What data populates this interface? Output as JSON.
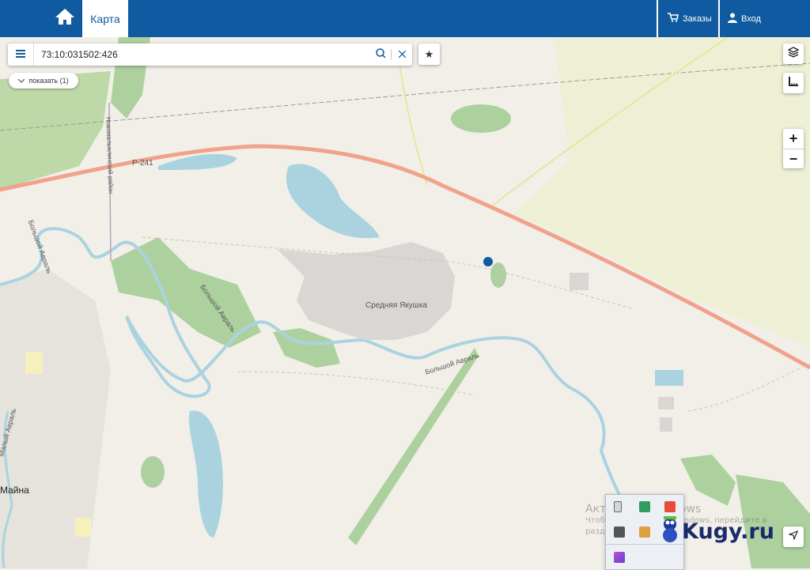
{
  "header": {
    "home_icon": "home-icon",
    "tab_map": "Карта",
    "orders": "Заказы",
    "login": "Вход"
  },
  "search": {
    "value": "73:10:031502:426",
    "search_icon": "search-icon",
    "clear_icon": "close-icon"
  },
  "favorite_icon": "star-icon",
  "results_toggle": "показать (1)",
  "controls": {
    "layers_icon": "layers-icon",
    "ruler_icon": "measure-icon",
    "zoom_in": "+",
    "zoom_out": "−",
    "locate_icon": "locate-icon"
  },
  "map": {
    "labels": {
      "road": "Р-241",
      "settlement": "Средняя Якушка",
      "river_1": "Большой Авраль",
      "river_2": "Большой Авраль",
      "river_3": "Большой Авраль",
      "river_left": "Малый Авраль",
      "district_line": "Новомалыклинский район",
      "town": "Майна"
    },
    "colors": {
      "background": "#f2efe9",
      "forest": "#add19e",
      "field": "#eef0d5",
      "water": "#aad3df",
      "road": "#f0a28a",
      "built": "#d9d7d4",
      "marker": "#0f5aa0"
    }
  },
  "overlay": {
    "watermark_title": "Активация Windows",
    "watermark_line1": "Чтобы активировать Windows, перейдите в",
    "watermark_line2": "раздел «Параметры».",
    "logo": "Kugy.ru"
  },
  "theme": {
    "primary": "#0f5aa0"
  }
}
